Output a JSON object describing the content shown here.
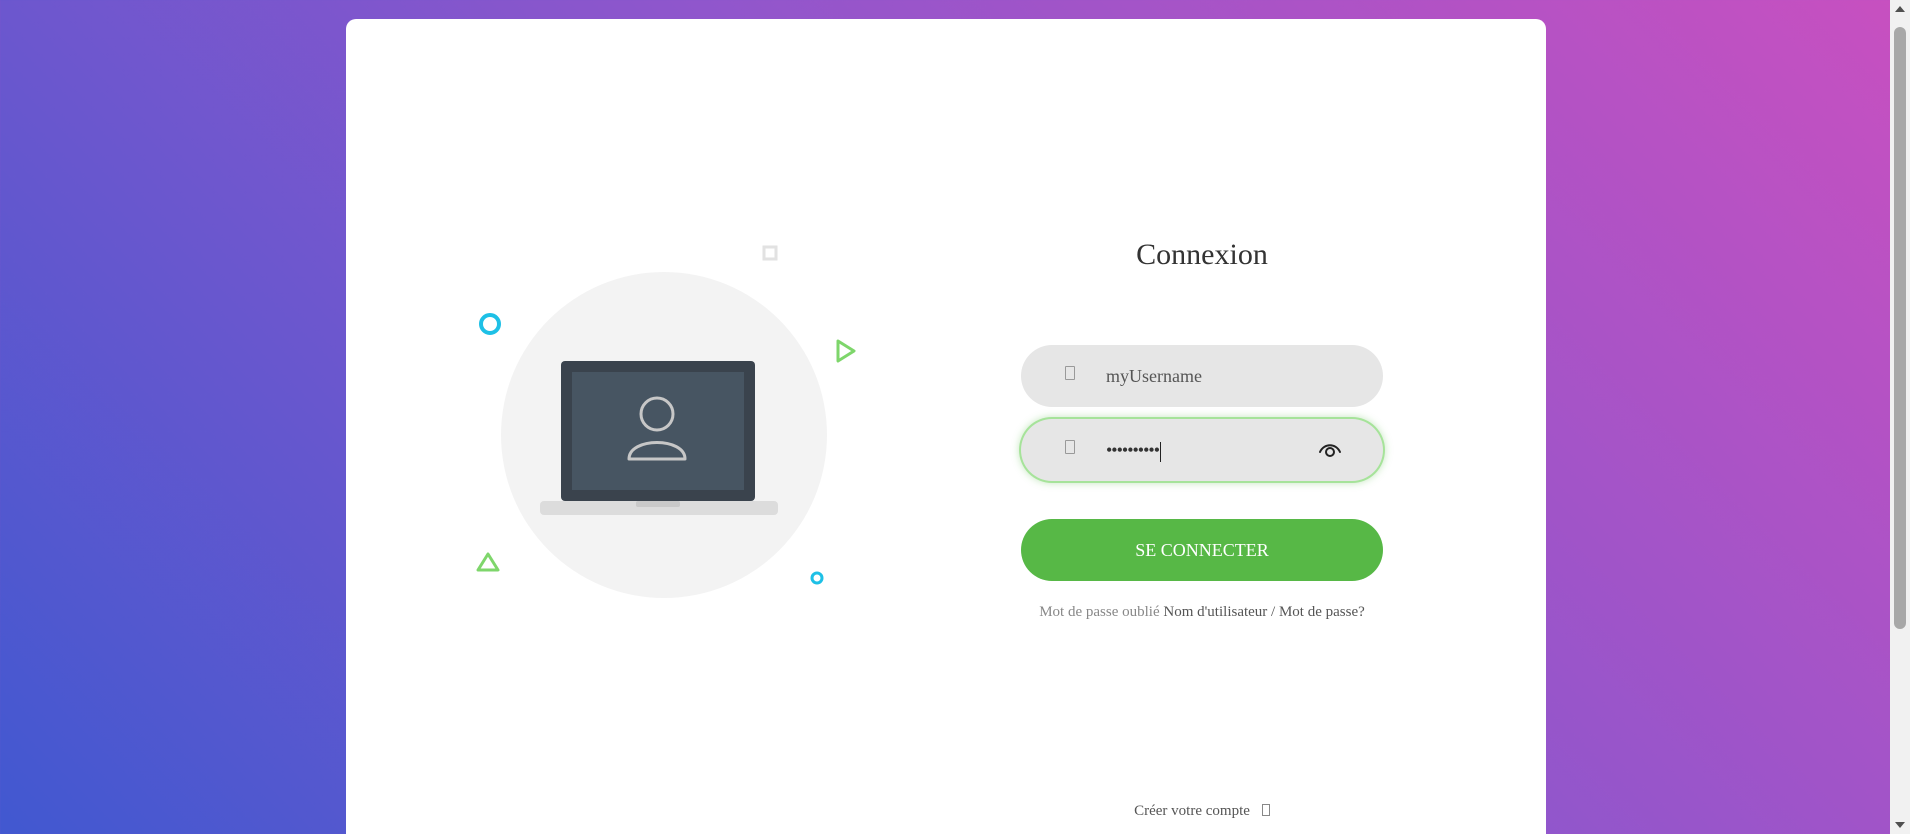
{
  "login": {
    "title": "Connexion",
    "username": {
      "value": "myUsername",
      "icon": "envelope-icon"
    },
    "password": {
      "masked_value": "••••••••••",
      "icon": "lock-icon",
      "toggle_icon": "eye-icon"
    },
    "submit_label": "SE CONNECTER",
    "forgot": {
      "prefix": "Mot de passe oublié",
      "link": "Nom d'utilisateur / Mot de passe?"
    },
    "create_account": {
      "label": "Créer votre compte",
      "icon": "arrow-right-icon"
    }
  },
  "illustration": {
    "icon": "user-laptop-icon"
  },
  "colors": {
    "accent": "#57b846",
    "gradient_start": "#4158d0",
    "gradient_end": "#c850c0",
    "decor_blue": "#1ec0e6",
    "decor_green": "#7ed66b"
  }
}
